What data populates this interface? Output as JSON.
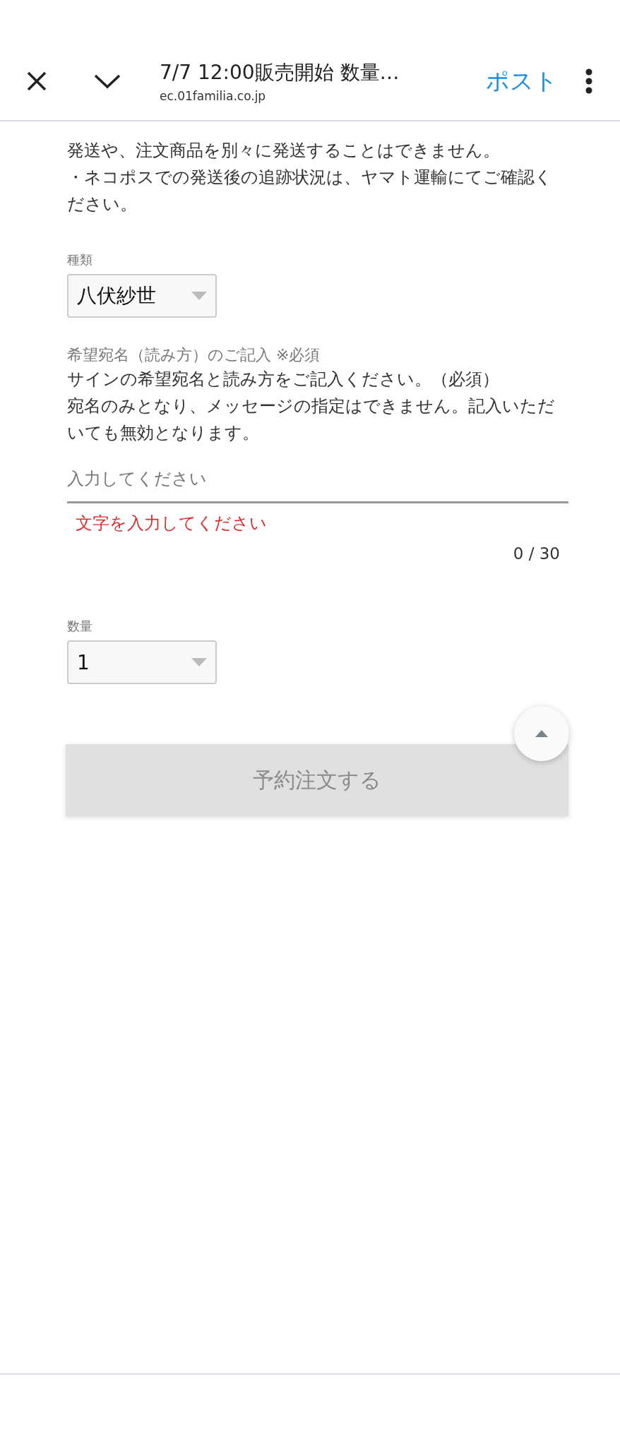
{
  "header": {
    "title": "7/7 12:00販売開始 数量…",
    "url": "ec.01familia.co.jp",
    "post_label": "ポスト"
  },
  "notice_lines": [
    "発送や、注文商品を別々に発送することはできません。",
    "・ネコポスでの発送後の追跡状況は、ヤマト運輸にてご確認ください。"
  ],
  "fields": [
    {
      "kind": "select",
      "label": "種類",
      "value": "八伏紗世"
    },
    {
      "kind": "text",
      "label": "希望宛名（読み方）のご記入 ※必須",
      "description": [
        "サインの希望宛名と読み方をご記入ください。（必須）",
        "宛名のみとなり、メッセージの指定はできません。記入いただいても無効となります。"
      ],
      "placeholder": "入力してください",
      "error": "文字を入力してください",
      "counter": "0 / 30"
    },
    {
      "kind": "select",
      "label": "数量",
      "value": "1"
    }
  ],
  "submit": {
    "label": "予約注文する",
    "disabled": true
  }
}
